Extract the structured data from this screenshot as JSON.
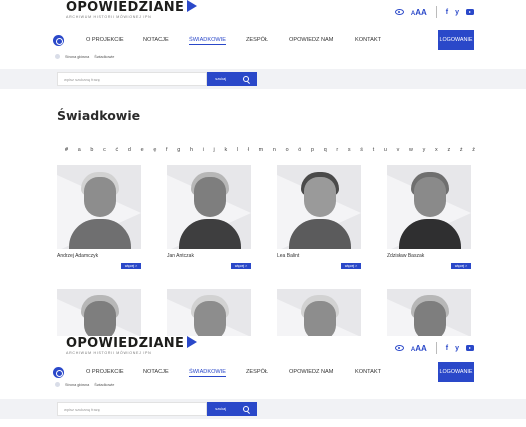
{
  "brand": {
    "name": "OPOWIEDZIANE",
    "tagline": "ARCHIWUM HISTORII MÓWIONEJ IPN",
    "accent_color": "#2a48c9"
  },
  "toolbar": {
    "contrast_icon": "eye-icon",
    "font_size_label_small": "A",
    "font_size_label_big": "AA",
    "social": [
      "f",
      "y"
    ],
    "youtube_icon": "youtube-icon"
  },
  "nav": {
    "items": [
      "O PROJEKCIE",
      "NOTACJE",
      "ŚWIADKOWIE",
      "ZESPÓŁ",
      "OPOWIEDZ NAM",
      "KONTAKT"
    ],
    "active": "ŚWIADKOWIE",
    "login_label": "LOGOWANIE"
  },
  "breadcrumb": [
    "Strona główna",
    "Świadkowie"
  ],
  "search": {
    "placeholder": "wpisz szukaną frazę",
    "button_label": "szukaj"
  },
  "page_title": "Świadkowie",
  "alphabet": [
    "#",
    "a",
    "b",
    "c",
    "ć",
    "d",
    "e",
    "ę",
    "f",
    "g",
    "h",
    "i",
    "j",
    "k",
    "l",
    "ł",
    "m",
    "n",
    "o",
    "ó",
    "p",
    "q",
    "r",
    "s",
    "ś",
    "t",
    "u",
    "v",
    "w",
    "y",
    "x",
    "z",
    "ż",
    "ź"
  ],
  "witnesses": [
    {
      "name": "Andrzej Adamczyk",
      "more_label": "więcej >"
    },
    {
      "name": "Jan Antczak",
      "more_label": "więcej >"
    },
    {
      "name": "Lea Balint",
      "more_label": "więcej >"
    },
    {
      "name": "Zdzisław Baszak",
      "more_label": "więcej >"
    }
  ]
}
